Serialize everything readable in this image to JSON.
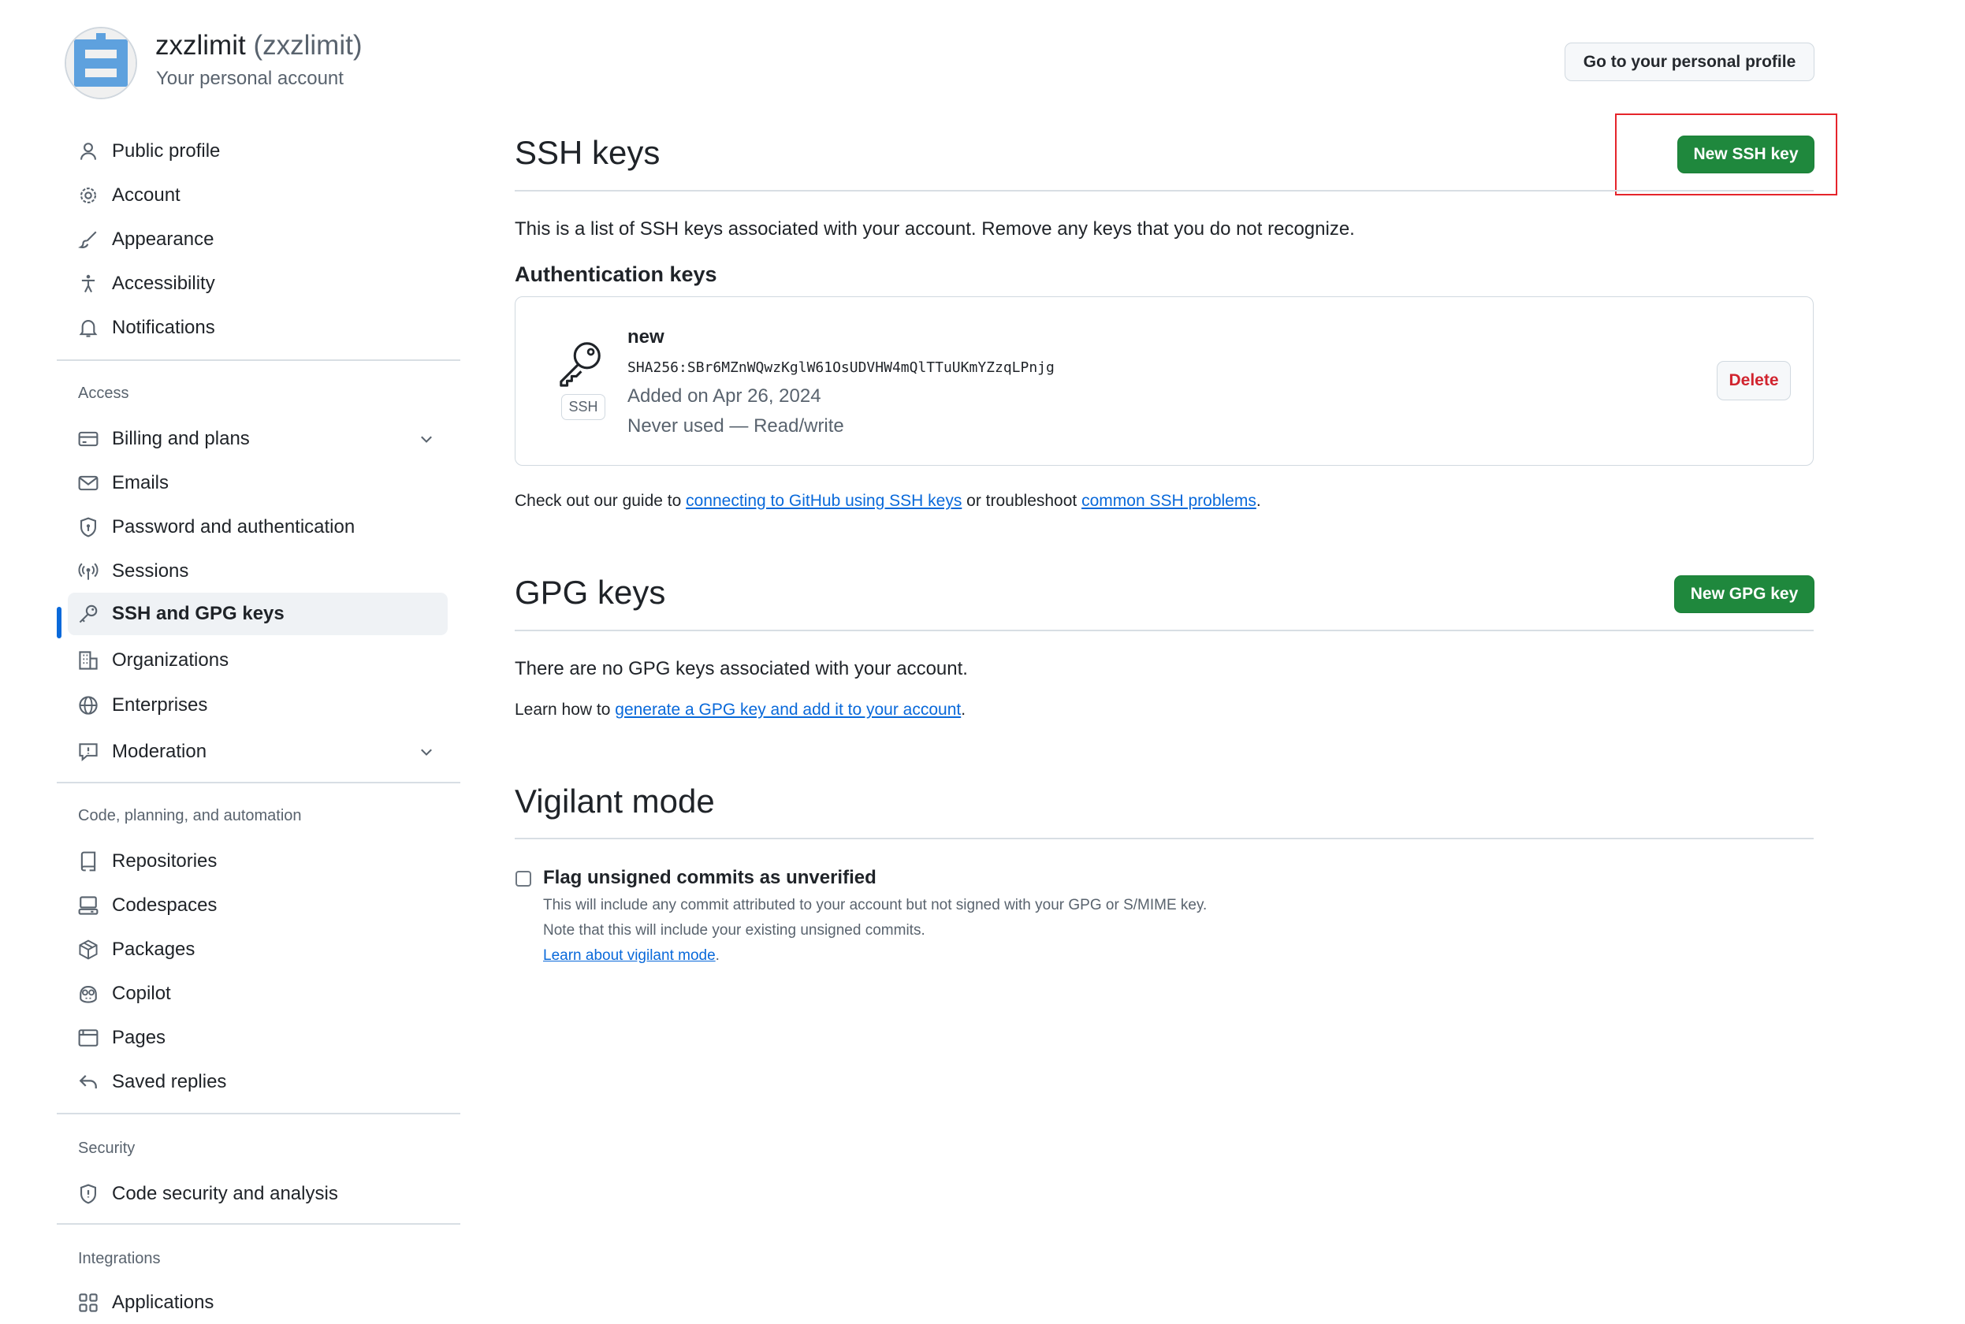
{
  "header": {
    "user_name": "zxzlimit",
    "user_login": "(zxzlimit)",
    "subtitle": "Your personal account",
    "profile_button": "Go to your personal profile"
  },
  "sidebar": {
    "items_top": [
      {
        "label": "Public profile",
        "icon": "person-icon"
      },
      {
        "label": "Account",
        "icon": "gear-icon"
      },
      {
        "label": "Appearance",
        "icon": "paintbrush-icon"
      },
      {
        "label": "Accessibility",
        "icon": "accessibility-icon"
      },
      {
        "label": "Notifications",
        "icon": "bell-icon"
      }
    ],
    "access_title": "Access",
    "access_items": [
      {
        "label": "Billing and plans",
        "icon": "credit-card-icon"
      },
      {
        "label": "Emails",
        "icon": "mail-icon"
      },
      {
        "label": "Password and authentication",
        "icon": "shield-lock-icon"
      },
      {
        "label": "Sessions",
        "icon": "broadcast-icon"
      },
      {
        "label": "SSH and GPG keys",
        "icon": "key-icon",
        "active": true
      },
      {
        "label": "Organizations",
        "icon": "organization-icon"
      },
      {
        "label": "Enterprises",
        "icon": "globe-icon"
      },
      {
        "label": "Moderation",
        "icon": "report-icon"
      }
    ],
    "code_title": "Code, planning, and automation",
    "code_items": [
      {
        "label": "Repositories",
        "icon": "repo-icon"
      },
      {
        "label": "Codespaces",
        "icon": "codespaces-icon"
      },
      {
        "label": "Packages",
        "icon": "package-icon"
      },
      {
        "label": "Copilot",
        "icon": "copilot-icon"
      },
      {
        "label": "Pages",
        "icon": "browser-icon"
      },
      {
        "label": "Saved replies",
        "icon": "reply-icon"
      }
    ],
    "security_title": "Security",
    "security_items": [
      {
        "label": "Code security and analysis",
        "icon": "shield-icon"
      }
    ],
    "integrations_title": "Integrations",
    "integrations_items": [
      {
        "label": "Applications",
        "icon": "apps-icon"
      }
    ]
  },
  "ssh": {
    "title": "SSH keys",
    "new_button": "New SSH key",
    "description": "This is a list of SSH keys associated with your account. Remove any keys that you do not recognize.",
    "auth_title": "Authentication keys",
    "key": {
      "name": "new",
      "fingerprint": "SHA256:SBr6MZnWQwzKglW61OsUDVHW4mQlTTuUKmYZzqLPnjg",
      "added": "Added on Apr 26, 2024",
      "usage": "Never used — Read/write",
      "type_label": "SSH",
      "delete_button": "Delete"
    },
    "guide_prefix": "Check out our guide to ",
    "guide_link1": "connecting to GitHub using SSH keys",
    "guide_middle": " or troubleshoot ",
    "guide_link2": "common SSH problems",
    "guide_suffix": "."
  },
  "gpg": {
    "title": "GPG keys",
    "new_button": "New GPG key",
    "empty": "There are no GPG keys associated with your account.",
    "learn_prefix": "Learn how to ",
    "learn_link": "generate a GPG key and add it to your account",
    "learn_suffix": "."
  },
  "vigilant": {
    "title": "Vigilant mode",
    "checkbox_label": "Flag unsigned commits as unverified",
    "checked": false,
    "note1": "This will include any commit attributed to your account but not signed with your GPG or S/MIME key.",
    "note2": "Note that this will include your existing unsigned commits.",
    "learn_link": "Learn about vigilant mode",
    "learn_suffix": "."
  },
  "colors": {
    "primary_button": "#1f883d",
    "link": "#0969da",
    "danger": "#d1242f",
    "active_indicator": "#0969da",
    "highlight_box": "#e5242b"
  }
}
